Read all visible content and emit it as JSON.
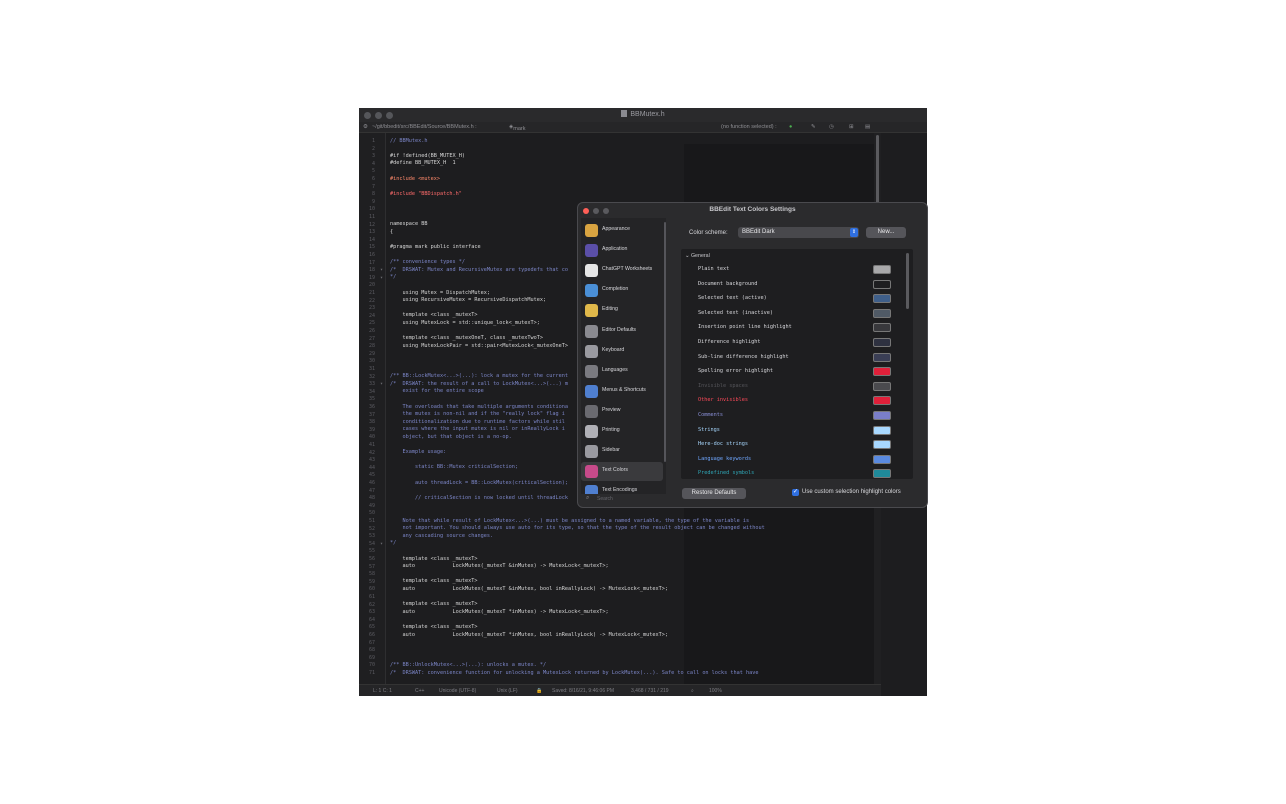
{
  "window": {
    "title": "BBMutex.h",
    "path": "~/git/bbedit/src/BBEdit/Source/BBMutex.h :",
    "symbol": "mark",
    "function_menu": "(no function selected) :"
  },
  "code_lines": [
    {
      "n": "1",
      "t": "// BBMutex.h",
      "c": "c-cmt"
    },
    {
      "n": "2",
      "t": "",
      "c": ""
    },
    {
      "n": "3",
      "t": "#if !defined(BB_MUTEX_H)",
      "c": ""
    },
    {
      "n": "4",
      "t": "#define BB_MUTEX_H  1",
      "c": ""
    },
    {
      "n": "5",
      "t": "",
      "c": ""
    },
    {
      "n": "6",
      "t": "#include <mutex>",
      "c": "c-pp"
    },
    {
      "n": "7",
      "t": "",
      "c": ""
    },
    {
      "n": "8",
      "t": "#include \"BBDispatch.h\"",
      "c": "c-str"
    },
    {
      "n": "9",
      "t": "",
      "c": ""
    },
    {
      "n": "10",
      "t": "",
      "c": ""
    },
    {
      "n": "11",
      "t": "",
      "c": ""
    },
    {
      "n": "12",
      "t": "namespace BB",
      "c": ""
    },
    {
      "n": "13",
      "t": "{",
      "c": ""
    },
    {
      "n": "14",
      "t": "",
      "c": ""
    },
    {
      "n": "15",
      "t": "#pragma mark public interface",
      "c": ""
    },
    {
      "n": "16",
      "t": "",
      "c": ""
    },
    {
      "n": "17",
      "t": "/** convenience types */",
      "c": "c-cmt"
    },
    {
      "n": "18",
      "t": "/*  DRSWAT: Mutex and RecursiveMutex are typedefs that co",
      "c": "c-cmt"
    },
    {
      "n": "19",
      "t": "*/",
      "c": "c-cmt"
    },
    {
      "n": "20",
      "t": "",
      "c": ""
    },
    {
      "n": "21",
      "t": "    using Mutex = DispatchMutex;",
      "c": ""
    },
    {
      "n": "22",
      "t": "    using RecursiveMutex = RecursiveDispatchMutex;",
      "c": ""
    },
    {
      "n": "23",
      "t": "",
      "c": ""
    },
    {
      "n": "24",
      "t": "    template <class _mutexT>",
      "c": ""
    },
    {
      "n": "25",
      "t": "    using MutexLock = std::unique_lock<_mutexT>;",
      "c": ""
    },
    {
      "n": "26",
      "t": "",
      "c": ""
    },
    {
      "n": "27",
      "t": "    template <class _mutexOneT, class _mutexTwoT>",
      "c": ""
    },
    {
      "n": "28",
      "t": "    using MutexLockPair = std::pair<MutexLock<_mutexOneT>",
      "c": ""
    },
    {
      "n": "29",
      "t": "",
      "c": ""
    },
    {
      "n": "30",
      "t": "",
      "c": ""
    },
    {
      "n": "31",
      "t": "",
      "c": ""
    },
    {
      "n": "32",
      "t": "/** BB::LockMutex<...>(...): lock a mutex for the current",
      "c": "c-cmt"
    },
    {
      "n": "33",
      "t": "/*  DRSWAT: the result of a call to LockMutex<...>(...) m",
      "c": "c-cmt"
    },
    {
      "n": "34",
      "t": "    exist for the entire scope",
      "c": "c-cmt"
    },
    {
      "n": "35",
      "t": "",
      "c": ""
    },
    {
      "n": "36",
      "t": "    The overloads that take multiple arguments conditiona",
      "c": "c-cmt"
    },
    {
      "n": "37",
      "t": "    the mutex is non-nil and if the \"really lock\" flag i",
      "c": "c-cmt"
    },
    {
      "n": "38",
      "t": "    conditionalization due to runtime factors while stil",
      "c": "c-cmt"
    },
    {
      "n": "39",
      "t": "    cases where the input mutex is nil or inReallyLock i",
      "c": "c-cmt"
    },
    {
      "n": "40",
      "t": "    object, but that object is a no-op.",
      "c": "c-cmt"
    },
    {
      "n": "41",
      "t": "",
      "c": ""
    },
    {
      "n": "42",
      "t": "    Example usage:",
      "c": "c-cmt"
    },
    {
      "n": "43",
      "t": "",
      "c": ""
    },
    {
      "n": "44",
      "t": "        static BB::Mutex criticalSection;",
      "c": "c-cmt"
    },
    {
      "n": "45",
      "t": "",
      "c": ""
    },
    {
      "n": "46",
      "t": "        auto threadLock = BB::LockMutex(criticalSection);",
      "c": "c-cmt"
    },
    {
      "n": "47",
      "t": "",
      "c": ""
    },
    {
      "n": "48",
      "t": "        // criticalSection is now locked until threadLock",
      "c": "c-cmt"
    },
    {
      "n": "49",
      "t": "",
      "c": ""
    },
    {
      "n": "50",
      "t": "",
      "c": ""
    },
    {
      "n": "51",
      "t": "    Note that while result of LockMutex<...>(...) must be assigned to a named variable, the type of the variable is",
      "c": "c-cmt"
    },
    {
      "n": "52",
      "t": "    not important. You should always use auto for its type, so that the type of the result object can be changed without",
      "c": "c-cmt"
    },
    {
      "n": "53",
      "t": "    any cascading source changes.",
      "c": "c-cmt"
    },
    {
      "n": "54",
      "t": "*/",
      "c": "c-cmt"
    },
    {
      "n": "55",
      "t": "",
      "c": ""
    },
    {
      "n": "56",
      "t": "    template <class _mutexT>",
      "c": ""
    },
    {
      "n": "57",
      "t": "    auto            LockMutex(_mutexT &inMutex) -> MutexLock<_mutexT>;",
      "c": ""
    },
    {
      "n": "58",
      "t": "",
      "c": ""
    },
    {
      "n": "59",
      "t": "    template <class _mutexT>",
      "c": ""
    },
    {
      "n": "60",
      "t": "    auto            LockMutex(_mutexT &inMutex, bool inReallyLock) -> MutexLock<_mutexT>;",
      "c": ""
    },
    {
      "n": "61",
      "t": "",
      "c": ""
    },
    {
      "n": "62",
      "t": "    template <class _mutexT>",
      "c": ""
    },
    {
      "n": "63",
      "t": "    auto            LockMutex(_mutexT *inMutex) -> MutexLock<_mutexT>;",
      "c": ""
    },
    {
      "n": "64",
      "t": "",
      "c": ""
    },
    {
      "n": "65",
      "t": "    template <class _mutexT>",
      "c": ""
    },
    {
      "n": "66",
      "t": "    auto            LockMutex(_mutexT *inMutex, bool inReallyLock) -> MutexLock<_mutexT>;",
      "c": ""
    },
    {
      "n": "67",
      "t": "",
      "c": ""
    },
    {
      "n": "68",
      "t": "",
      "c": ""
    },
    {
      "n": "69",
      "t": "",
      "c": ""
    },
    {
      "n": "70",
      "t": "/** BB::UnlockMutex<...>(...): unlocks a mutex. */",
      "c": "c-cmt"
    },
    {
      "n": "71",
      "t": "/*  DRSWAT: convenience function for unlocking a MutexLock returned by LockMutex(...). Safe to call on locks that have",
      "c": "c-cmt"
    }
  ],
  "status": {
    "position": "L: 1 C: 1",
    "language": "C++",
    "encoding": "Unicode (UTF-8)",
    "line_endings": "Unix (LF)",
    "saved": "Saved: 8/16/21, 9:46:06 PM",
    "counts": "3,468 / 731 / 219",
    "zoom": "100%"
  },
  "dialog": {
    "title": "BBEdit Text Colors Settings",
    "sidebar": [
      {
        "label": "Appearance",
        "icon": "appearance-icon",
        "color": "#d9a441"
      },
      {
        "label": "Application",
        "icon": "application-icon",
        "color": "#5b4fa8"
      },
      {
        "label": "ChatGPT Worksheets",
        "icon": "chatgpt-icon",
        "color": "#e6e6e6"
      },
      {
        "label": "Completion",
        "icon": "completion-icon",
        "color": "#4a8fd6"
      },
      {
        "label": "Editing",
        "icon": "editing-icon",
        "color": "#e0b84a"
      },
      {
        "label": "Editor Defaults",
        "icon": "editor-defaults-icon",
        "color": "#8a8a90"
      },
      {
        "label": "Keyboard",
        "icon": "keyboard-icon",
        "color": "#9a9aa0"
      },
      {
        "label": "Languages",
        "icon": "languages-icon",
        "color": "#7a7a80"
      },
      {
        "label": "Menus & Shortcuts",
        "icon": "menus-icon",
        "color": "#4f7fd0"
      },
      {
        "label": "Preview",
        "icon": "preview-icon",
        "color": "#6a6a70"
      },
      {
        "label": "Printing",
        "icon": "printing-icon",
        "color": "#b0b0b6"
      },
      {
        "label": "Sidebar",
        "icon": "sidebar-icon",
        "color": "#9a9aa0"
      },
      {
        "label": "Text Colors",
        "icon": "text-colors-icon",
        "color": "#c74a8a"
      },
      {
        "label": "Text Encodings",
        "icon": "text-encodings-icon",
        "color": "#4f7fd0"
      }
    ],
    "search_placeholder": "Search",
    "color_scheme_label": "Color scheme:",
    "color_scheme_value": "BBEdit Dark",
    "new_button": "New...",
    "section": "General",
    "rows": [
      {
        "label": "Plain text",
        "text_color": "#d8d8dc",
        "swatch": "#a8a8aa"
      },
      {
        "label": "Document background",
        "text_color": "#d8d8dc",
        "swatch": "#1e1e20"
      },
      {
        "label": "Selected text (active)",
        "text_color": "#d8d8dc",
        "swatch": "#3f5f8a"
      },
      {
        "label": "Selected text (inactive)",
        "text_color": "#d8d8dc",
        "swatch": "#505a66"
      },
      {
        "label": "Insertion point line highlight",
        "text_color": "#d8d8dc",
        "swatch": "#38383c"
      },
      {
        "label": "Difference highlight",
        "text_color": "#d8d8dc",
        "swatch": "#2e3140"
      },
      {
        "label": "Sub-line difference highlight",
        "text_color": "#d8d8dc",
        "swatch": "#3a3e55"
      },
      {
        "label": "Spelling error highlight",
        "text_color": "#d8d8dc",
        "swatch": "#e0203a"
      },
      {
        "label": "Invisible spaces",
        "text_color": "#55555a",
        "swatch": "#4a4a4e"
      },
      {
        "label": "Other invisibles",
        "text_color": "#ff4a5a",
        "swatch": "#e0203a"
      },
      {
        "label": "Comments",
        "text_color": "#8a90d8",
        "swatch": "#7a7ec8"
      },
      {
        "label": "Strings",
        "text_color": "#a8d8ff",
        "swatch": "#a8d8ff"
      },
      {
        "label": "Here-doc strings",
        "text_color": "#a8d8ff",
        "swatch": "#a8d8ff"
      },
      {
        "label": "Language keywords",
        "text_color": "#6fa7ff",
        "swatch": "#5a8ae0"
      },
      {
        "label": "Predefined symbols",
        "text_color": "#2fa8b8",
        "swatch": "#1f8a9a"
      }
    ],
    "restore_button": "Restore Defaults",
    "checkbox_label": "Use custom selection highlight colors"
  }
}
